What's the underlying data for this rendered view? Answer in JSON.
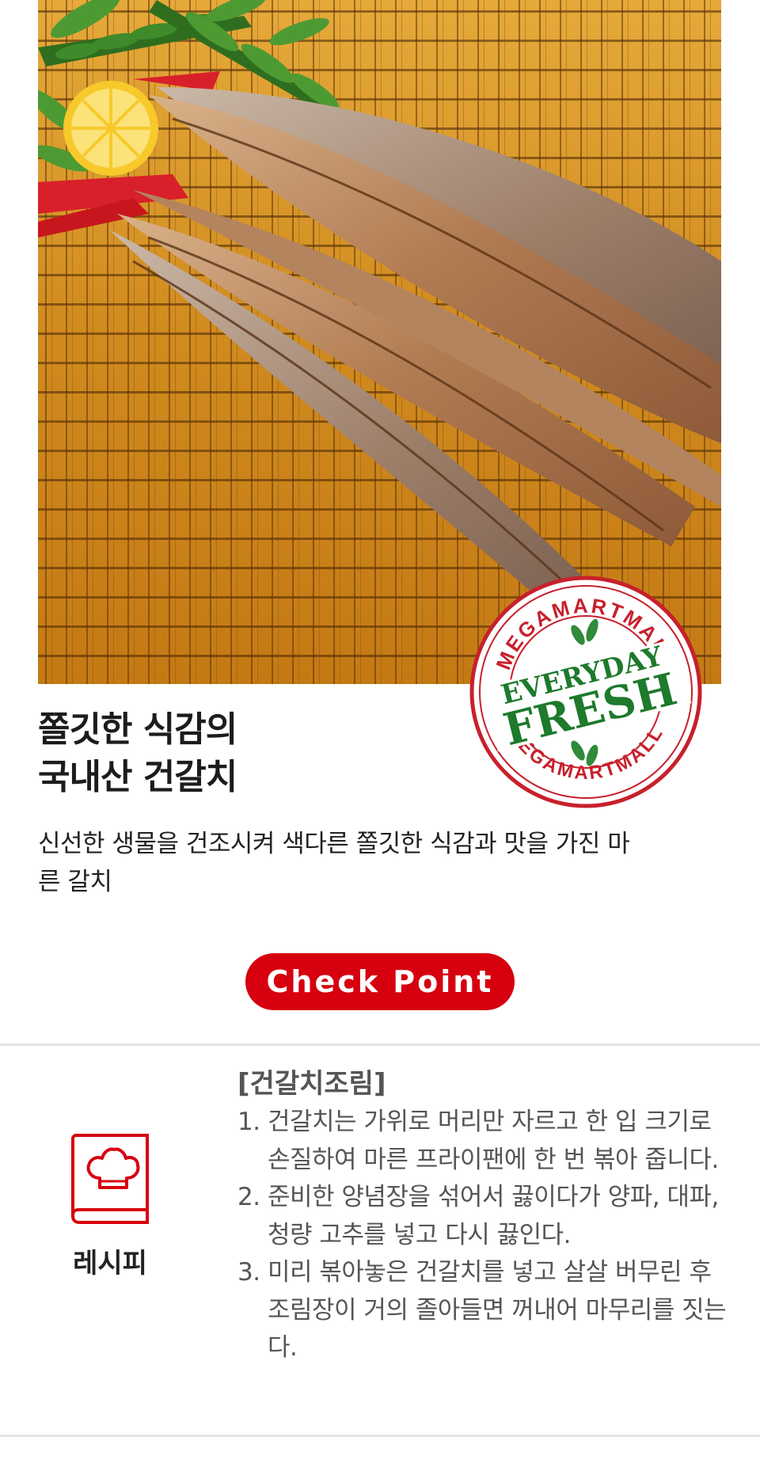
{
  "hero": {
    "image_alt": "dried hairtail fish on a bamboo mat with lemon and fern",
    "stamp": {
      "top_text": "MEGAMARTMALL",
      "line1": "EVERYDAY",
      "line2": "FRESH",
      "bottom_text": "MEGAMARTMALL",
      "red": "#c8202c",
      "green": "#1e7a2c"
    }
  },
  "product": {
    "headline_line1": "쫄깃한 식감의",
    "headline_line2": "국내산 건갈치",
    "description": "신선한 생물을 건조시켜 색다른 쫄깃한 식감과 맛을 가진 마른 갈치"
  },
  "check_point": {
    "label": "Check Point",
    "color": "#d6000f"
  },
  "recipe": {
    "label": "레시피",
    "title": "[건갈치조림]",
    "steps": [
      {
        "num": "1.",
        "text": "건갈치는 가위로 머리만 자르고 한 입 크기로 손질하여 마른 프라이팬에 한 번 볶아 줍니다."
      },
      {
        "num": "2.",
        "text": "준비한 양념장을 섞어서 끓이다가 양파, 대파, 청량 고추를 넣고 다시 끓인다."
      },
      {
        "num": "3.",
        "text": "미리 볶아놓은 건갈치를 넣고 살살 버무린 후 조림장이 거의 졸아들면 꺼내어 마무리를 짓는다."
      }
    ]
  },
  "icons": [
    "chef-hat-book-icon",
    "lemon-icon",
    "fern-icon"
  ]
}
